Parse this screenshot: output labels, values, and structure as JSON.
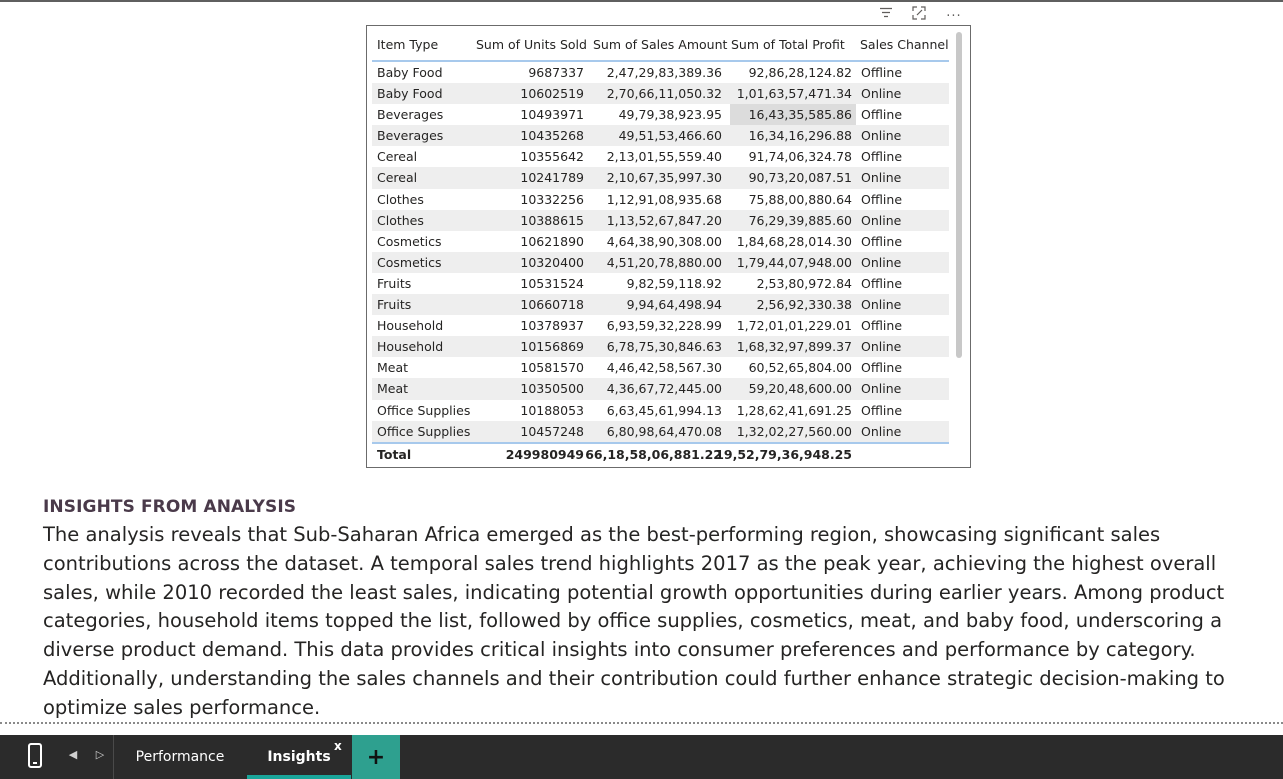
{
  "visual_header": {
    "filter_icon": "filter-icon",
    "focus_icon": "focus-mode-icon",
    "more_icon": "more-options-icon",
    "more_label": "..."
  },
  "table": {
    "columns": [
      "Item Type",
      "Sum of Units Sold",
      "Sum of Sales Amount",
      "Sum of Total Profit",
      "Sales Channel"
    ],
    "rows": [
      [
        "Baby Food",
        "9687337",
        "2,47,29,83,389.36",
        "92,86,28,124.82",
        "Offline"
      ],
      [
        "Baby Food",
        "10602519",
        "2,70,66,11,050.32",
        "1,01,63,57,471.34",
        "Online"
      ],
      [
        "Beverages",
        "10493971",
        "49,79,38,923.95",
        "16,43,35,585.86",
        "Offline"
      ],
      [
        "Beverages",
        "10435268",
        "49,51,53,466.60",
        "16,34,16,296.88",
        "Online"
      ],
      [
        "Cereal",
        "10355642",
        "2,13,01,55,559.40",
        "91,74,06,324.78",
        "Offline"
      ],
      [
        "Cereal",
        "10241789",
        "2,10,67,35,997.30",
        "90,73,20,087.51",
        "Online"
      ],
      [
        "Clothes",
        "10332256",
        "1,12,91,08,935.68",
        "75,88,00,880.64",
        "Offline"
      ],
      [
        "Clothes",
        "10388615",
        "1,13,52,67,847.20",
        "76,29,39,885.60",
        "Online"
      ],
      [
        "Cosmetics",
        "10621890",
        "4,64,38,90,308.00",
        "1,84,68,28,014.30",
        "Offline"
      ],
      [
        "Cosmetics",
        "10320400",
        "4,51,20,78,880.00",
        "1,79,44,07,948.00",
        "Online"
      ],
      [
        "Fruits",
        "10531524",
        "9,82,59,118.92",
        "2,53,80,972.84",
        "Offline"
      ],
      [
        "Fruits",
        "10660718",
        "9,94,64,498.94",
        "2,56,92,330.38",
        "Online"
      ],
      [
        "Household",
        "10378937",
        "6,93,59,32,228.99",
        "1,72,01,01,229.01",
        "Offline"
      ],
      [
        "Household",
        "10156869",
        "6,78,75,30,846.63",
        "1,68,32,97,899.37",
        "Online"
      ],
      [
        "Meat",
        "10581570",
        "4,46,42,58,567.30",
        "60,52,65,804.00",
        "Offline"
      ],
      [
        "Meat",
        "10350500",
        "4,36,67,72,445.00",
        "59,20,48,600.00",
        "Online"
      ],
      [
        "Office Supplies",
        "10188053",
        "6,63,45,61,994.13",
        "1,28,62,41,691.25",
        "Offline"
      ],
      [
        "Office Supplies",
        "10457248",
        "6,80,98,64,470.08",
        "1,32,02,27,560.00",
        "Online"
      ]
    ],
    "total": [
      "Total",
      "249980949",
      "66,18,58,06,881.22",
      "19,52,79,36,948.25",
      ""
    ]
  },
  "insights": {
    "title": "INSIGHTS FROM ANALYSIS",
    "body": "The analysis reveals that Sub-Saharan Africa emerged as the best-performing region, showcasing significant sales contributions across the dataset. A temporal sales trend highlights 2017 as the peak year, achieving the highest overall sales, while 2010 recorded the least sales, indicating potential growth opportunities during earlier years. Among product categories, household items topped the list, followed by office supplies, cosmetics, meat, and baby food, underscoring a diverse product demand. This data provides critical insights into consumer preferences and performance by category. Additionally, understanding the sales channels and their contribution could further enhance strategic decision-making to optimize sales performance."
  },
  "bottom_bar": {
    "mobile_icon": "mobile-layout-icon",
    "prev_icon": "chevron-left-icon",
    "next_icon": "chevron-right-icon",
    "tabs": [
      {
        "label": "Performance",
        "active": false
      },
      {
        "label": "Insights",
        "active": true
      }
    ],
    "close_label": "x",
    "add_label": "+",
    "accent": "#1aa59a"
  }
}
